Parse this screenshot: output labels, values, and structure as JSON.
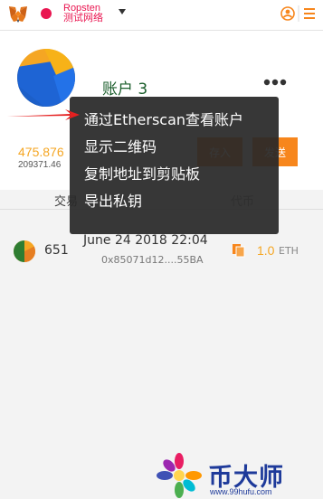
{
  "header": {
    "network_name": "Ropsten",
    "network_subtitle": "测试网络",
    "network_dot_color": "#e91550",
    "logo_icon": "metamask-fox-icon",
    "menu_icon": "hamburger-menu-icon",
    "account_icon": "account-switch-icon"
  },
  "account": {
    "name": "账户 3",
    "balance": "475.876",
    "balance_usd": "209371.46",
    "deposit_label": "存入",
    "send_label": "发送",
    "more_icon": "more-dots-icon"
  },
  "tabs": {
    "transactions_label": "交易",
    "tokens_label": "代币"
  },
  "transactions": [
    {
      "nonce": "651",
      "date": "June 24 2018 22:04",
      "hash": "0x85071d12....55BA",
      "amount": "1.0",
      "unit": "ETH"
    }
  ],
  "menu": {
    "items": [
      "通过Etherscan查看账户",
      "显示二维码",
      "复制地址到剪贴板",
      "导出私钥"
    ]
  },
  "watermark": {
    "text": "币大师",
    "url": "www.99hufu.com"
  },
  "colors": {
    "accent": "#f7861c",
    "account_name": "#1b5e2c",
    "balance": "#f5a623"
  }
}
